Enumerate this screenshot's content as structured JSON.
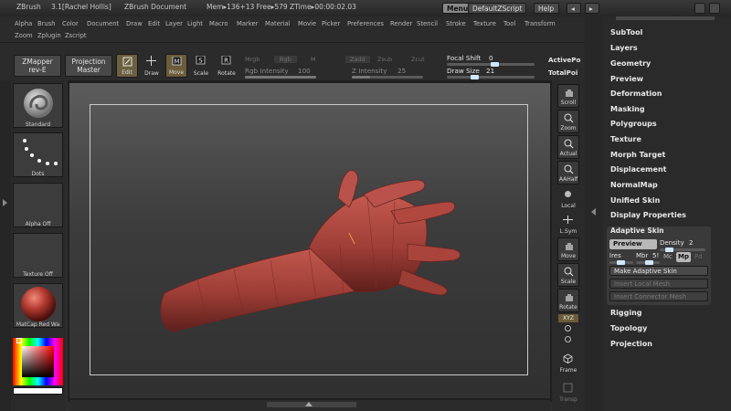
{
  "titlebar": {
    "app": "ZBrush",
    "version_user": "3.1[Rachel Hollis]",
    "document": "ZBrush Document",
    "stats": "Mem▸136+13 Free▸579 ZTime▸00:00:02.03",
    "menus_btn": "Menus",
    "script_btn": "DefaultZScript",
    "help_btn": "Help"
  },
  "menubar": {
    "row1": [
      "Alpha",
      "Brush",
      "Color",
      "Document",
      "Draw",
      "Edit",
      "Layer",
      "Light",
      "Macro",
      "Marker",
      "Material",
      "Movie",
      "Picker",
      "Preferences",
      "Render",
      "Stencil",
      "Stroke",
      "Texture",
      "Tool",
      "Transform"
    ],
    "row2": [
      "Zoom",
      "Zplugin",
      "Zscript"
    ]
  },
  "toolbar": {
    "zmapper_line1": "ZMapper",
    "zmapper_line2": "rev-E",
    "projection_line1": "Projection",
    "projection_line2": "Master",
    "edit": "Edit",
    "draw": "Draw",
    "move": "Move",
    "scale": "Scale",
    "rotate": "Rotate",
    "mrgb": "Mrgb",
    "rgb": "Rgb",
    "m": "M",
    "zadd": "Zadd",
    "zsub": "Zsub",
    "zcut": "Zcut",
    "rgb_intensity_label": "Rgb Intensity",
    "rgb_intensity_value": "100",
    "z_intensity_label": "Z Intensity",
    "z_intensity_value": "25",
    "focal_shift_label": "Focal Shift",
    "focal_shift_value": "0",
    "draw_size_label": "Draw Size",
    "draw_size_value": "21",
    "active_points": "ActivePo",
    "total_points": "TotalPoi"
  },
  "left_tray": {
    "brush": "Standard",
    "stroke": "Dots",
    "alpha": "Alpha Off",
    "texture": "Texture Off",
    "material": "MatCap Red Wa"
  },
  "right_tray": [
    "Scroll",
    "Zoom",
    "Actual",
    "AAHalf",
    "Local",
    "L.Sym",
    "Move",
    "Scale",
    "Rotate",
    "XYZ",
    "",
    "",
    "Frame",
    "Transp"
  ],
  "panel": {
    "top_items": [
      "SubTool",
      "Layers",
      "Geometry",
      "Preview",
      "Deformation",
      "Masking",
      "Polygroups",
      "Texture",
      "Morph Target",
      "Displacement",
      "NormalMap",
      "Unified Skin",
      "Display Properties"
    ],
    "adaptive_title": "Adaptive Skin",
    "preview_btn": "Preview",
    "density_label": "Density",
    "density_value": "2",
    "ires_label": "Ires",
    "mbr_label": "Mbr",
    "mbr_value": "5!",
    "mc_label": "Mc",
    "mp_label": "Mp",
    "pd_label": "Pd",
    "make_btn": "Make Adaptive Skin",
    "insert_local_btn": "Insert Local Mesh",
    "insert_connector_btn": "Insert Connector Mesh",
    "bottom_items": [
      "Rigging",
      "Topology",
      "Projection"
    ]
  },
  "colors": {
    "mesh": "#b04a42",
    "accent_blue": "#cfe7ff",
    "panel_bg": "#2a2a2a"
  }
}
